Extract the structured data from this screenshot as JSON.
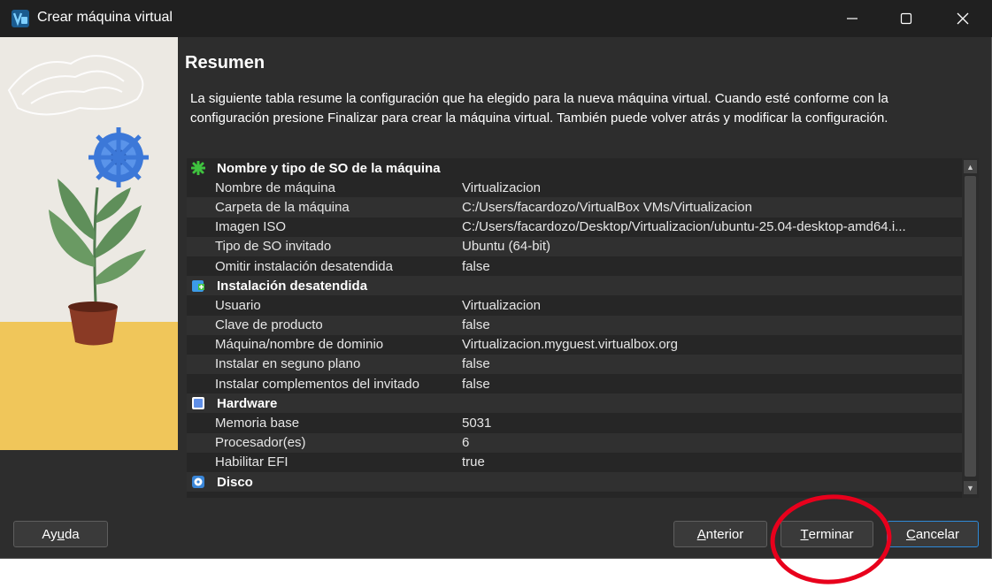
{
  "window": {
    "title": "Crear máquina virtual"
  },
  "page": {
    "heading": "Resumen",
    "description": "La siguiente tabla resume la configuración que ha elegido para la nueva máquina virtual. Cuando esté conforme con la configuración presione Finalizar para crear la máquina virtual. También puede volver atrás y modificar la configuración."
  },
  "sections": [
    {
      "title": "Nombre y tipo de SO de la máquina",
      "icon": "os-type-icon",
      "color": "#3fc23f",
      "rows": [
        {
          "key": "Nombre de máquina",
          "value": "Virtualizacion"
        },
        {
          "key": "Carpeta de la máquina",
          "value": "C:/Users/facardozo/VirtualBox VMs/Virtualizacion"
        },
        {
          "key": "Imagen ISO",
          "value": "C:/Users/facardozo/Desktop/Virtualizacion/ubuntu-25.04-desktop-amd64.i..."
        },
        {
          "key": "Tipo de SO invitado",
          "value": "Ubuntu (64-bit)"
        },
        {
          "key": "Omitir instalación desatendida",
          "value": "false"
        }
      ]
    },
    {
      "title": "Instalación desatendida",
      "icon": "unattended-install-icon",
      "color": "#3c9be8",
      "rows": [
        {
          "key": "Usuario",
          "value": "Virtualizacion"
        },
        {
          "key": "Clave de producto",
          "value": "false"
        },
        {
          "key": "Máquina/nombre de dominio",
          "value": "Virtualizacion.myguest.virtualbox.org"
        },
        {
          "key": "Instalar en seguno plano",
          "value": "false"
        },
        {
          "key": "Instalar complementos del invitado",
          "value": "false"
        }
      ]
    },
    {
      "title": "Hardware",
      "icon": "hardware-icon",
      "color": "#5f8fe8",
      "rows": [
        {
          "key": "Memoria base",
          "value": "5031"
        },
        {
          "key": "Procesador(es)",
          "value": "6"
        },
        {
          "key": "Habilitar EFI",
          "value": "true"
        }
      ]
    },
    {
      "title": "Disco",
      "icon": "disk-icon",
      "color": "#3a86d8",
      "rows": []
    }
  ],
  "buttons": {
    "help": {
      "pre": "Ay",
      "u": "u",
      "post": "da"
    },
    "back": {
      "pre": "",
      "u": "A",
      "post": "nterior"
    },
    "finish": {
      "pre": "",
      "u": "T",
      "post": "erminar"
    },
    "cancel": {
      "pre": "",
      "u": "C",
      "post": "ancelar"
    }
  },
  "accent": "#2e8ad8",
  "annotation_color": "#e8001c"
}
